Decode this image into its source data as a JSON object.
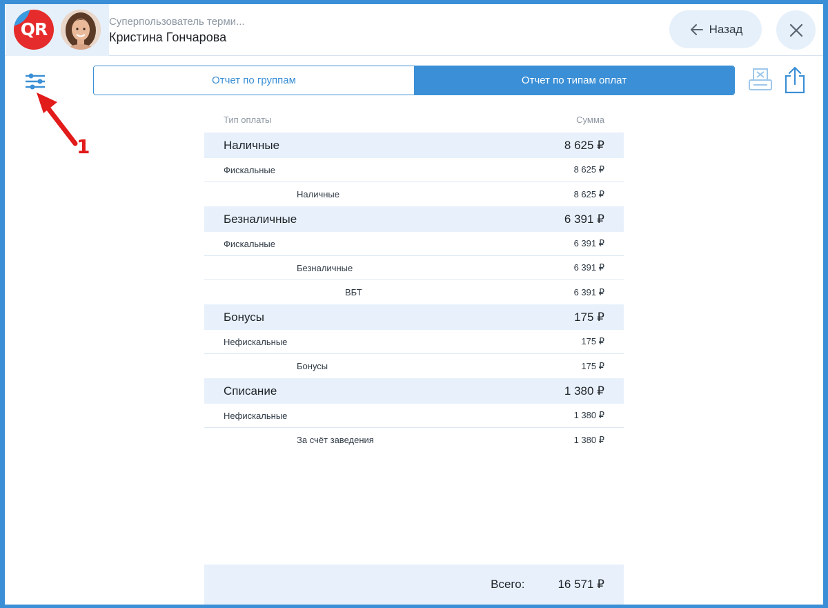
{
  "header": {
    "logo_text": "QR",
    "user_role": "Суперпользователь терми...",
    "user_name": "Кристина Гончарова",
    "back_label": "Назад"
  },
  "annotation": {
    "number": "1"
  },
  "tabs": [
    {
      "label": "Отчет по группам",
      "active": false
    },
    {
      "label": "Отчет по типам оплат",
      "active": true
    }
  ],
  "table": {
    "headers": {
      "type": "Тип оплаты",
      "sum": "Сумма"
    },
    "rows": [
      {
        "kind": "group",
        "label": "Наличные",
        "sum": "8 625 ₽"
      },
      {
        "kind": "sub",
        "level": 1,
        "label": "Фискальные",
        "sum": "8 625 ₽"
      },
      {
        "kind": "sub",
        "level": 2,
        "label": "Наличные",
        "sum": "8 625 ₽"
      },
      {
        "kind": "group",
        "label": "Безналичные",
        "sum": "6 391 ₽"
      },
      {
        "kind": "sub",
        "level": 1,
        "label": "Фискальные",
        "sum": "6 391 ₽"
      },
      {
        "kind": "sub",
        "level": 2,
        "label": "Безналичные",
        "sum": "6 391 ₽"
      },
      {
        "kind": "sub",
        "level": 3,
        "label": "ВБТ",
        "sum": "6 391 ₽"
      },
      {
        "kind": "group",
        "label": "Бонусы",
        "sum": "175 ₽"
      },
      {
        "kind": "sub",
        "level": 1,
        "label": "Нефискальные",
        "sum": "175 ₽"
      },
      {
        "kind": "sub",
        "level": 2,
        "label": "Бонусы",
        "sum": "175 ₽"
      },
      {
        "kind": "group",
        "label": "Списание",
        "sum": "1 380 ₽"
      },
      {
        "kind": "sub",
        "level": 1,
        "label": "Нефискальные",
        "sum": "1 380 ₽"
      },
      {
        "kind": "sub",
        "level": 2,
        "label": "За счёт заведения",
        "sum": "1 380 ₽"
      }
    ]
  },
  "total": {
    "label": "Всего:",
    "value": "16 571 ₽"
  },
  "icons": {
    "filter": "sliders-icon",
    "print": "print-receipt-icon",
    "share": "share-icon",
    "back": "arrow-left-icon",
    "close": "close-icon"
  },
  "colors": {
    "accent": "#3a8fd6",
    "row_highlight": "#e8f1fb",
    "annotation": "#e21b1b"
  }
}
